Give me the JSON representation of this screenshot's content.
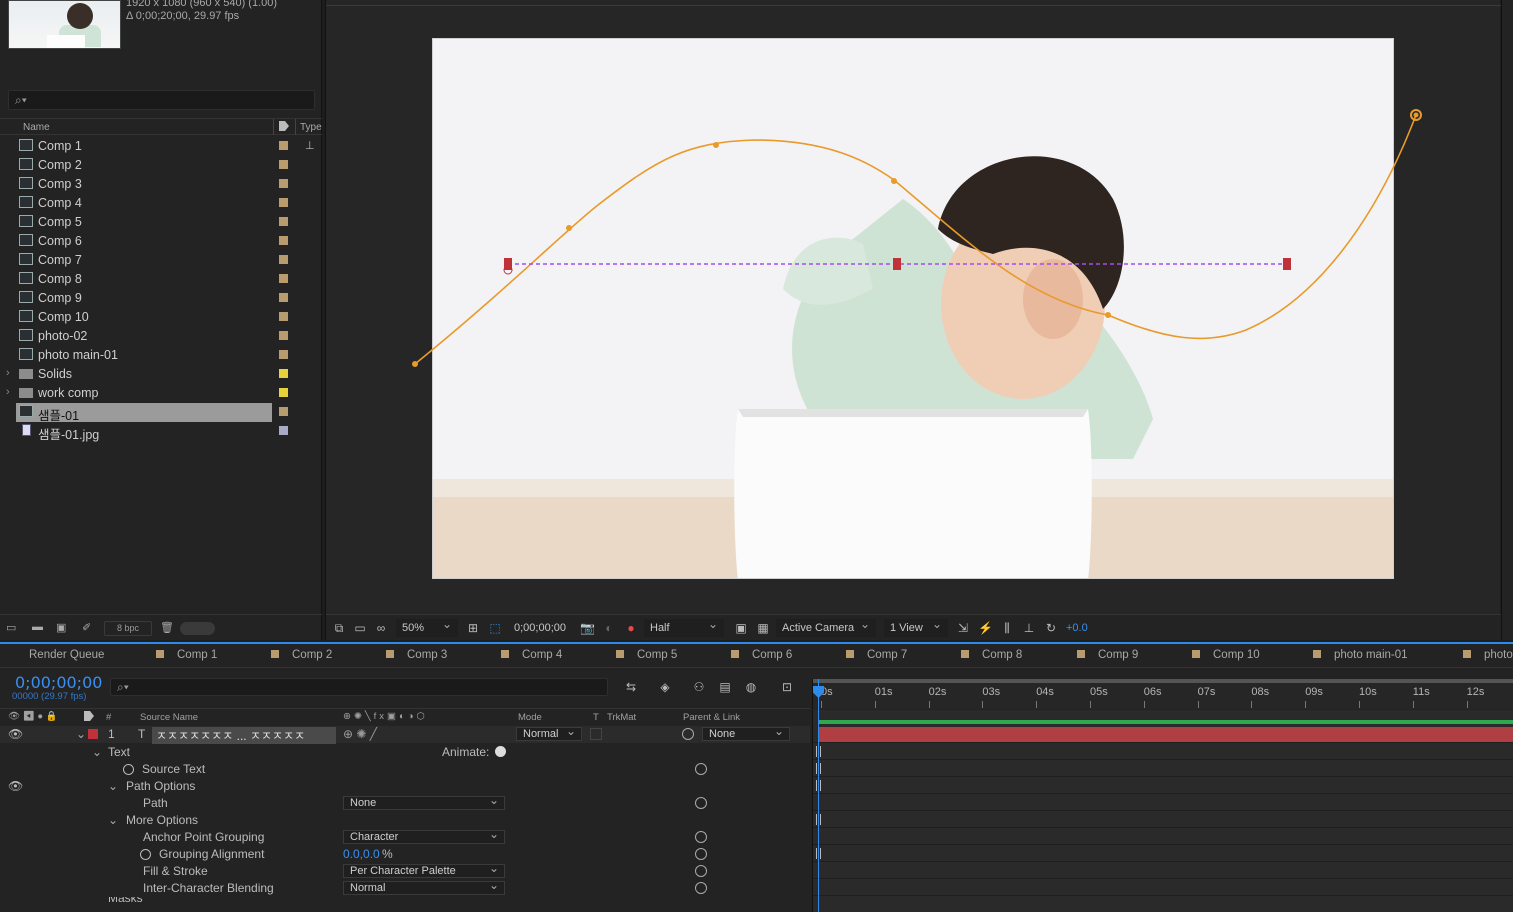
{
  "project": {
    "info_line1": "1920 x 1080  (960 x 540) (1.00)",
    "info_line2": "Δ 0;00;20;00, 29.97 fps",
    "search_placeholder": "⌕▾",
    "col_name": "Name",
    "col_type": "Type",
    "bpc": "8 bpc",
    "items": [
      {
        "name": "Comp 1",
        "kind": "comp",
        "color": "#b89c6e"
      },
      {
        "name": "Comp 2",
        "kind": "comp",
        "color": "#b89c6e"
      },
      {
        "name": "Comp 3",
        "kind": "comp",
        "color": "#b89c6e"
      },
      {
        "name": "Comp 4",
        "kind": "comp",
        "color": "#b89c6e"
      },
      {
        "name": "Comp 5",
        "kind": "comp",
        "color": "#b89c6e"
      },
      {
        "name": "Comp 6",
        "kind": "comp",
        "color": "#b89c6e"
      },
      {
        "name": "Comp 7",
        "kind": "comp",
        "color": "#b89c6e"
      },
      {
        "name": "Comp 8",
        "kind": "comp",
        "color": "#b89c6e"
      },
      {
        "name": "Comp 9",
        "kind": "comp",
        "color": "#b89c6e"
      },
      {
        "name": "Comp 10",
        "kind": "comp",
        "color": "#b89c6e"
      },
      {
        "name": "photo-02",
        "kind": "comp",
        "color": "#b89c6e"
      },
      {
        "name": "photo main-01",
        "kind": "comp",
        "color": "#b89c6e"
      },
      {
        "name": "Solids",
        "kind": "folder",
        "color": "#e6d23a"
      },
      {
        "name": "work comp",
        "kind": "folder",
        "color": "#e6d23a"
      },
      {
        "name": "샘플-01",
        "kind": "comp",
        "color": "#b89c6e",
        "selected": true
      },
      {
        "name": "샘플-01.jpg",
        "kind": "image",
        "color": "#a9a9c9"
      }
    ]
  },
  "viewer": {
    "zoom": "50%",
    "timecode": "0;00;00;00",
    "resolution": "Half",
    "camera": "Active Camera",
    "views": "1 View",
    "exposure": "+0.0"
  },
  "timeline": {
    "tabs": [
      "Render Queue",
      "Comp 1",
      "Comp 2",
      "Comp 3",
      "Comp 4",
      "Comp 5",
      "Comp 6",
      "Comp 7",
      "Comp 8",
      "Comp 9",
      "Comp 10",
      "photo main-01",
      "photo"
    ],
    "timecode": "0;00;00;00",
    "timecode_sub": "00000 (29.97 fps)",
    "search_placeholder": "⌕▾",
    "headers": {
      "hash": "#",
      "source_name": "Source Name",
      "mode": "Mode",
      "t": "T",
      "trkmat": "TrkMat",
      "parent": "Parent & Link"
    },
    "layer": {
      "index": "1",
      "type_icon": "T",
      "name": "ㅈㅈㅈㅈㅈㅈㅈ ... ㅈㅈㅈㅈㅈ",
      "mode": "Normal",
      "parent": "None"
    },
    "props": {
      "text": "Text",
      "animate": "Animate:",
      "source_text": "Source Text",
      "path_options": "Path Options",
      "path": "Path",
      "path_value": "None",
      "more_options": "More Options",
      "anchor_grouping": "Anchor Point Grouping",
      "anchor_grouping_value": "Character",
      "grouping_alignment": "Grouping Alignment",
      "grouping_alignment_value": "0.0,0.0",
      "grouping_alignment_unit": "%",
      "fill_stroke": "Fill & Stroke",
      "fill_stroke_value": "Per Character Palette",
      "inter_char": "Inter-Character Blending",
      "inter_char_value": "Normal",
      "masks": "Masks"
    },
    "ruler": [
      "0s",
      "01s",
      "02s",
      "03s",
      "04s",
      "05s",
      "06s",
      "07s",
      "08s",
      "09s",
      "10s",
      "11s",
      "12s",
      "1"
    ]
  },
  "colors": {
    "accent": "#2d8ceb",
    "path_orange": "#e89a2a",
    "text_path_purple": "#a64cf0",
    "layer_red": "#b03f44"
  }
}
